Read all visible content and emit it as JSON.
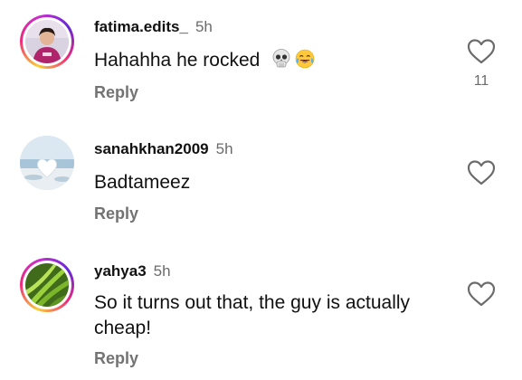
{
  "comments": [
    {
      "username": "fatima.edits_",
      "time": "5h",
      "text": "Hahahha he rocked",
      "reply_label": "Reply",
      "like_count": "11",
      "has_story_ring": true,
      "emojis": [
        "skull-emoji",
        "tears-of-joy-emoji"
      ]
    },
    {
      "username": "sanahkhan2009",
      "time": "5h",
      "text": "Badtameez",
      "reply_label": "Reply",
      "has_story_ring": false
    },
    {
      "username": "yahya3",
      "time": "5h",
      "text": "So it turns out that, the guy is actually cheap!",
      "reply_label": "Reply",
      "has_story_ring": true
    }
  ],
  "colors": {
    "text": "#111111",
    "secondary": "#737373",
    "ring_start": "#f9ce34",
    "ring_mid": "#ee2a7b",
    "ring_end": "#6228d7"
  }
}
